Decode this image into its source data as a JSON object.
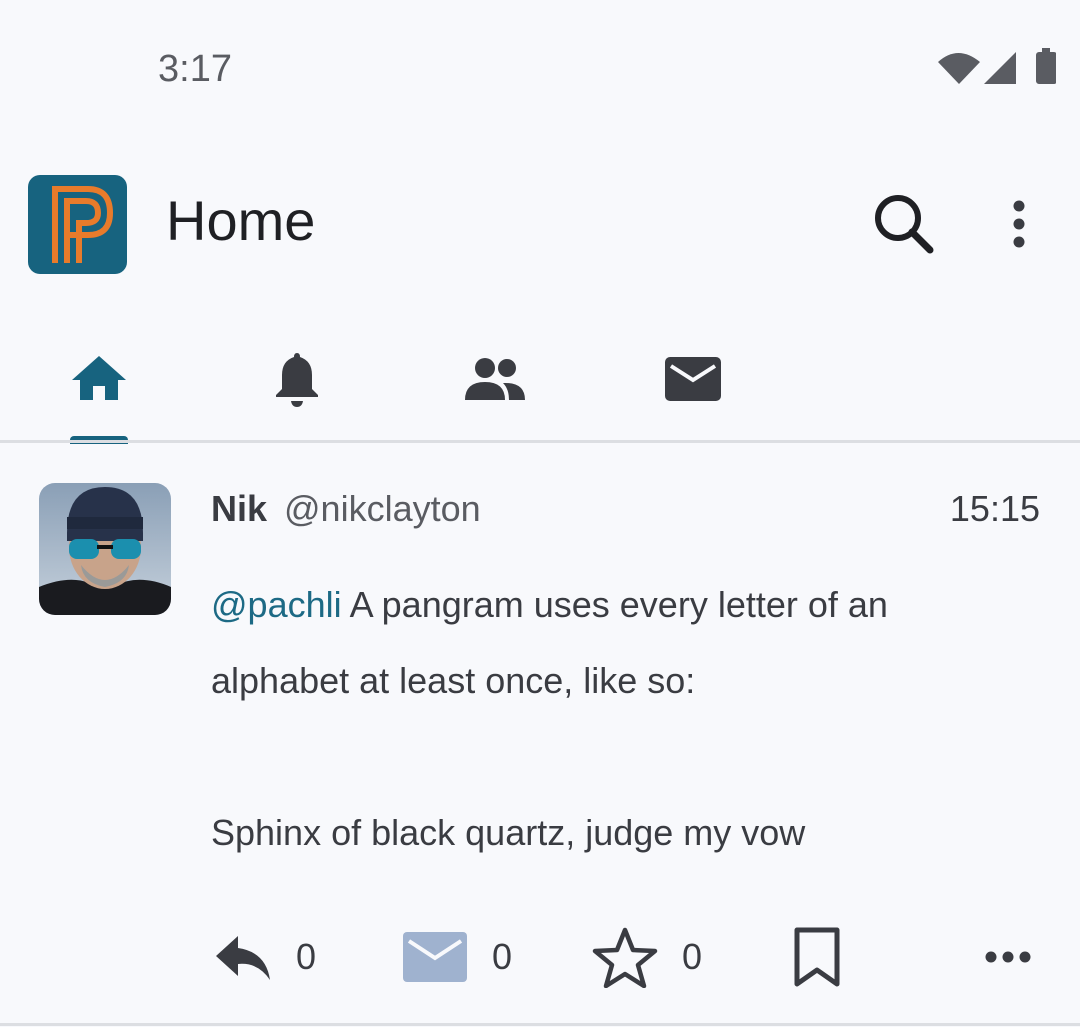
{
  "status_bar": {
    "time": "3:17",
    "icons": [
      "wifi-icon",
      "signal-icon",
      "battery-icon"
    ]
  },
  "app_bar": {
    "title": "Home",
    "logo_icon": "pachli-logo-icon"
  },
  "tabs": [
    {
      "name": "home",
      "icon": "home-icon",
      "selected": true
    },
    {
      "name": "notifications",
      "icon": "bell-icon",
      "selected": false
    },
    {
      "name": "people",
      "icon": "people-icon",
      "selected": false
    },
    {
      "name": "direct-messages",
      "icon": "mail-icon",
      "selected": false
    }
  ],
  "colors": {
    "accent": "#17637f",
    "background": "#f8f9fc",
    "text": "#3a3c42",
    "mention": "#1d6a85",
    "icon_dark": "#3a3c42",
    "dm_icon": "#9fb2cf",
    "logo_orange": "#e87b2b"
  },
  "post": {
    "display_name": "Nik",
    "username": "@nikclayton",
    "time": "15:15",
    "content": {
      "mention": "@pachli",
      "line1_rest": " A pangram uses every letter of an",
      "line2": "alphabet at least once, like so:",
      "line3": "Sphinx of black quartz, judge my vow"
    },
    "actions": {
      "reply_count": "0",
      "dm_count": "0",
      "favourite_count": "0"
    }
  }
}
